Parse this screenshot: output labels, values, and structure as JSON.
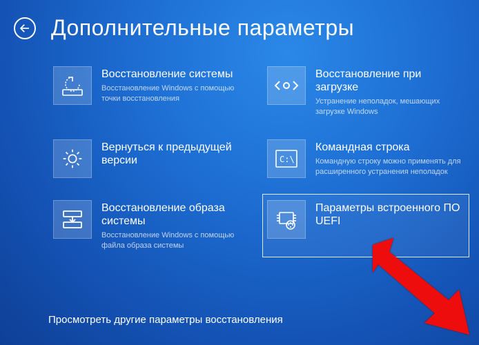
{
  "header": {
    "title": "Дополнительные параметры"
  },
  "tiles": [
    {
      "title": "Восстановление системы",
      "desc": "Восстановление Windows с помощью точки восстановления"
    },
    {
      "title": "Восстановление при загрузке",
      "desc": "Устранение неполадок, мешающих загрузке Windows"
    },
    {
      "title": "Вернуться к предыдущей версии",
      "desc": ""
    },
    {
      "title": "Командная строка",
      "desc": "Командную строку можно применять для расширенного устранения неполадок"
    },
    {
      "title": "Восстановление образа системы",
      "desc": "Восстановление Windows с помощью файла образа системы"
    },
    {
      "title": "Параметры встроенного ПО UEFI",
      "desc": ""
    }
  ],
  "footer": {
    "more": "Просмотреть другие параметры восстановления"
  }
}
